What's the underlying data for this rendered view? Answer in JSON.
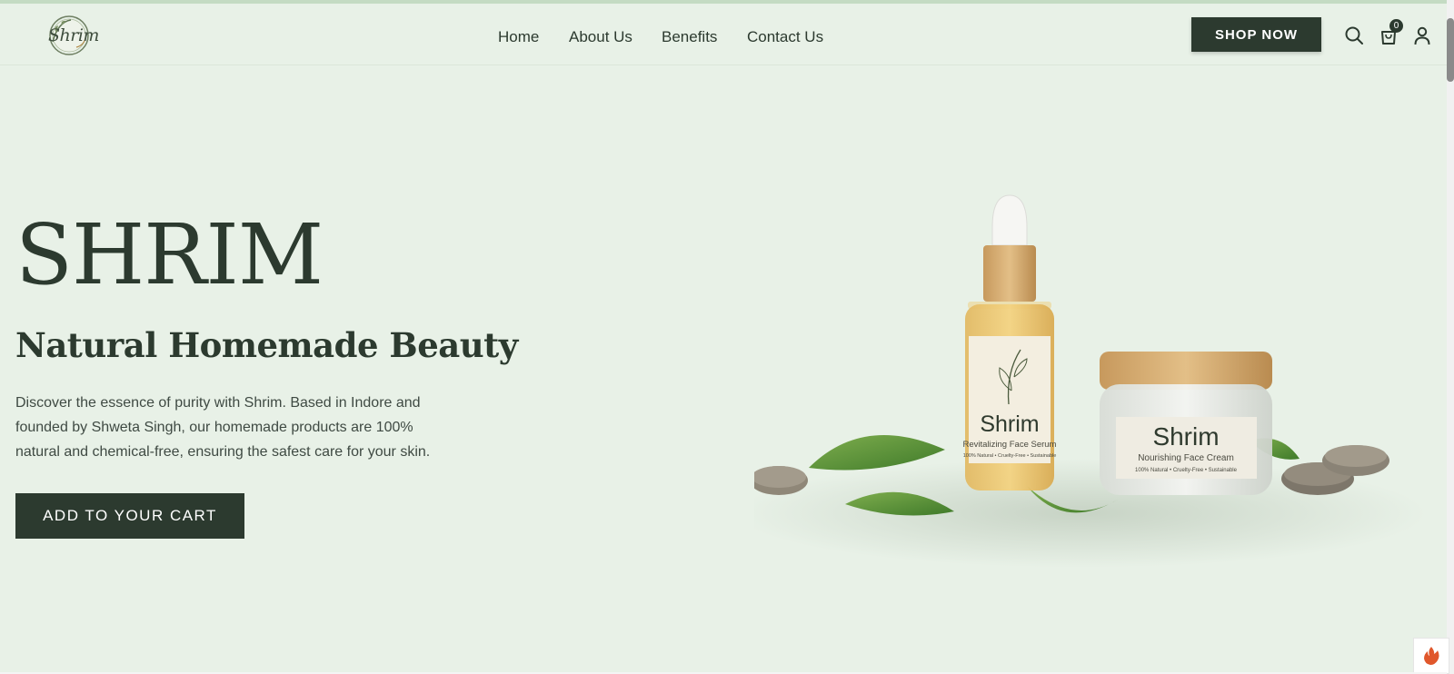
{
  "header": {
    "logo_text": "Shrim",
    "nav": [
      {
        "label": "Home"
      },
      {
        "label": "About Us"
      },
      {
        "label": "Benefits"
      },
      {
        "label": "Contact Us"
      }
    ],
    "shop_button": "SHOP NOW",
    "cart_count": "0",
    "icons": [
      "search-icon",
      "cart-icon",
      "user-icon"
    ]
  },
  "hero": {
    "title": "SHRIM",
    "subtitle": "Natural Homemade Beauty",
    "description": "Discover the essence of purity with Shrim. Based in Indore and founded by Shweta Singh, our homemade products are 100% natural and chemical-free, ensuring the safest care for your skin.",
    "cta": "ADD TO YOUR CART"
  },
  "products": {
    "serum": {
      "brand": "Shrim",
      "name": "Revitalizing Face Serum",
      "tagline": "100% Natural • Cruelty-Free • Sustainable"
    },
    "cream": {
      "brand": "Shrim",
      "name": "Nourishing Face Cream",
      "tagline": "100% Natural • Cruelty-Free • Sustainable"
    }
  },
  "colors": {
    "background": "#e8f1e7",
    "primary": "#2c3a2f",
    "button_text": "#ffffff"
  }
}
